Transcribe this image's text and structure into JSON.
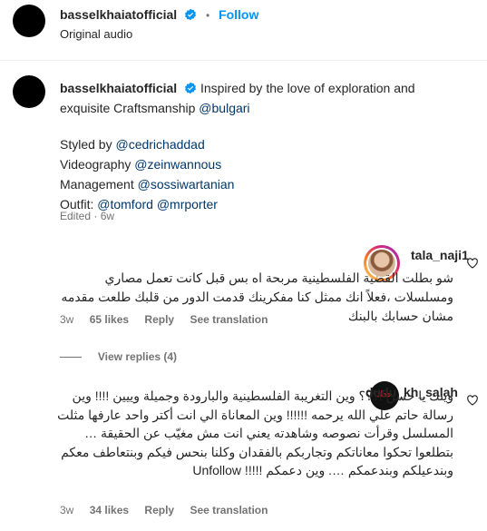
{
  "header": {
    "username": "basselkhaiatofficial",
    "separator": "•",
    "follow_label": "Follow",
    "audio_label": "Original audio"
  },
  "caption": {
    "username": "basselkhaiatofficial",
    "text": "Inspired by the love of exploration and exquisite Craftsmanship",
    "mention_brand": "@bulgari",
    "lines": [
      {
        "label": "Styled by",
        "mention": "@cedrichaddad"
      },
      {
        "label": "Videography",
        "mention": "@zeinwannous"
      },
      {
        "label": "Management",
        "mention": "@sossiwartanian"
      },
      {
        "label": "Outfit:",
        "mention": "@tomford @mrporter"
      }
    ],
    "edited": "Edited · 6w"
  },
  "comments": [
    {
      "username": "tala_naji1",
      "text": "شو بطلت القضية الفلسطينية مربحة اه بس قبل كانت تعمل مصاري ومسلسلات ،فعلاً انك ممثل كنا مفكرينك قدمت الدور من قلبك طلعت مقدمه مشان حسابك بالبنك",
      "age": "3w",
      "likes": "65 likes",
      "reply_label": "Reply",
      "translate_label": "See translation",
      "view_replies": "View replies (4)"
    },
    {
      "username": "dudu_kh_salah",
      "text": "وينك يا حسن !؟؟؟ وين التغريبة الفلسطينية والبارودة وجميلة وييين !!!! وين رسالة حاتم علي الله يرحمه !!!!!! وين المعاناة الي انت أكتر واحد عارفها مثلت المسلسل وقرأت نصوصه وشاهدته يعني انت مش مغيّب عن الحقيقة …بتطلعوا تحكوا معاناتكم وتجاربكم بالفقدان وكلنا بنحس فيكم وبنتعاطف معكم وبندعيلكم وبندعمكم …. وين دعمكم !!!!! Unfollow",
      "avatar_text": "حداد",
      "age": "3w",
      "likes": "34 likes",
      "reply_label": "Reply",
      "translate_label": "See translation"
    }
  ],
  "colors": {
    "link": "#00376b",
    "accent": "#0095f6",
    "verified": "#0095f6",
    "muted": "#737373"
  }
}
